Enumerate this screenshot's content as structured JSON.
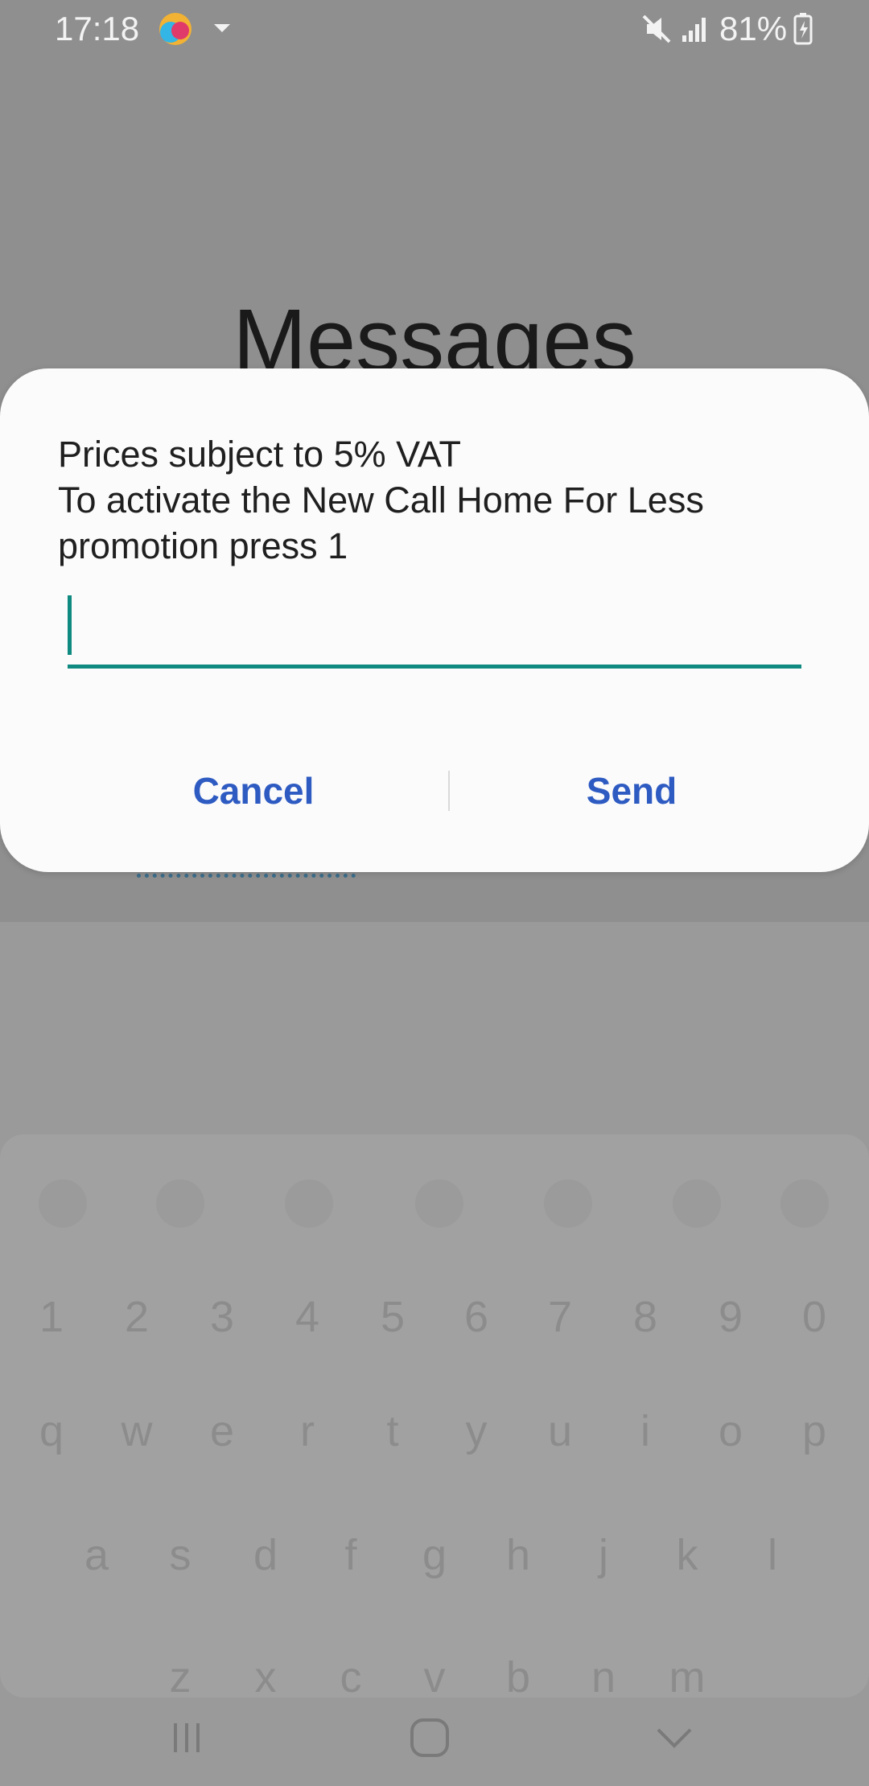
{
  "status_bar": {
    "time": "17:18",
    "battery": "81%",
    "icons": [
      "app-notification-icon",
      "expand-caret-icon",
      "mute-icon",
      "signal-icon",
      "battery-charging-icon"
    ]
  },
  "app": {
    "title": "Messages"
  },
  "dialog": {
    "message": "Prices subject to 5% VAT\nTo activate the New Call Home For Less\npromotion press 1",
    "input_value": "",
    "cancel_label": "Cancel",
    "send_label": "Send"
  },
  "keyboard": {
    "toolbar_icons": [
      "language-switch-icon",
      "emoji-icon",
      "sticker-icon",
      "clipboard-icon",
      "microphone-icon",
      "settings-icon",
      "more-icon"
    ],
    "number_row": [
      "1",
      "2",
      "3",
      "4",
      "5",
      "6",
      "7",
      "8",
      "9",
      "0"
    ],
    "row1": [
      "q",
      "w",
      "e",
      "r",
      "t",
      "y",
      "u",
      "i",
      "o",
      "p"
    ],
    "row2": [
      "a",
      "s",
      "d",
      "f",
      "g",
      "h",
      "j",
      "k",
      "l"
    ],
    "row3": [
      "z",
      "x",
      "c",
      "v",
      "b",
      "n",
      "m"
    ]
  },
  "nav": {
    "icons": [
      "recent-apps-icon",
      "home-icon",
      "back-icon"
    ]
  },
  "colors": {
    "accent": "#0f8a80",
    "button_text": "#2e5bc2",
    "scrim": "#8f8f8f"
  }
}
